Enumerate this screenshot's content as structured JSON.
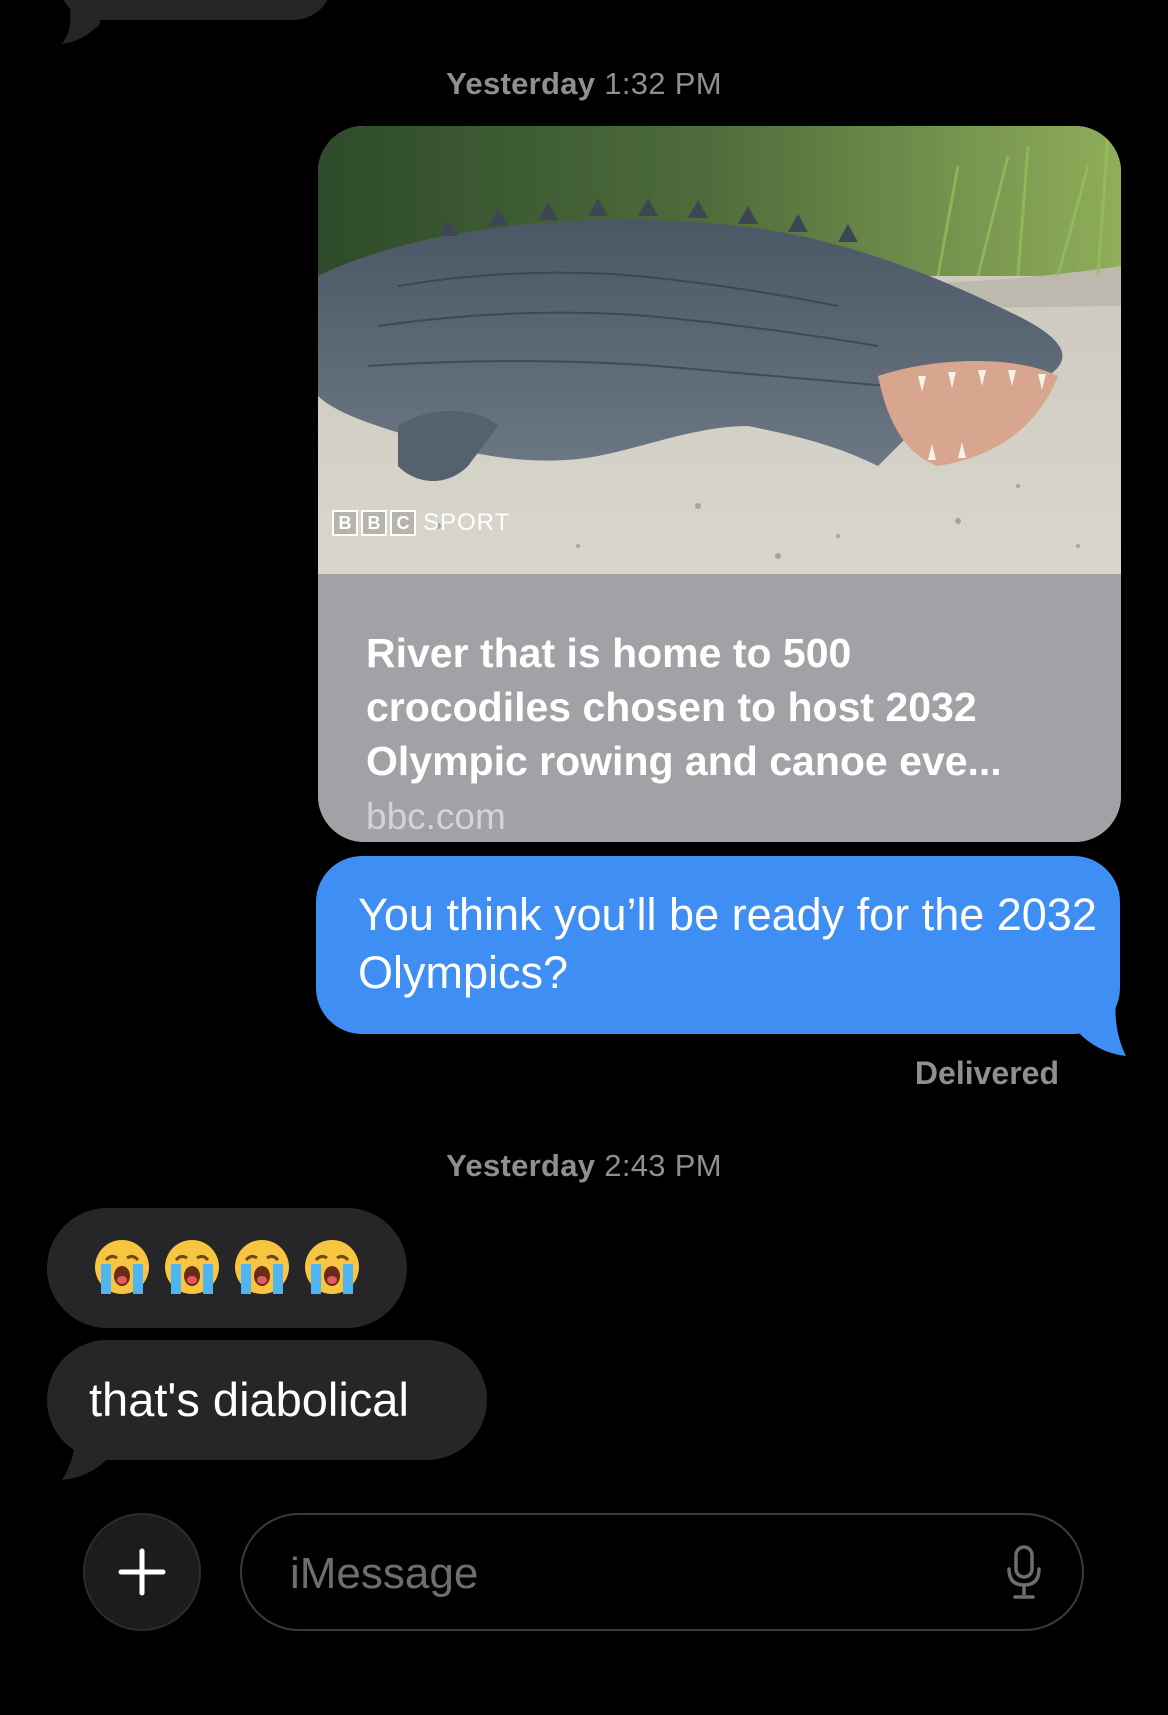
{
  "timestamps": [
    {
      "day": "Yesterday",
      "time": "1:32 PM"
    },
    {
      "day": "Yesterday",
      "time": "2:43 PM"
    }
  ],
  "link_preview": {
    "image_brand_box_letters": [
      "B",
      "B",
      "C"
    ],
    "image_brand_word": "SPORT",
    "title": "River that is home to 500 crocodiles chosen to host 2032 Olympic rowing and canoe eve...",
    "domain": "bbc.com"
  },
  "outgoing_message": {
    "text": "You think you’ll be ready for the 2032 Olympics?",
    "status": "Delivered"
  },
  "incoming_messages": {
    "emoji_names": [
      "loudly-crying-face-icon",
      "loudly-crying-face-icon",
      "loudly-crying-face-icon",
      "loudly-crying-face-icon"
    ],
    "text": "that's diabolical"
  },
  "composer": {
    "placeholder": "iMessage",
    "plus_icon": "plus-icon",
    "mic_icon": "microphone-icon"
  },
  "colors": {
    "background": "#000000",
    "outgoing_bubble": "#3f8ef4",
    "incoming_bubble": "#262628",
    "link_info_bg": "#a1a1a6",
    "secondary_text": "#8e8e93"
  }
}
